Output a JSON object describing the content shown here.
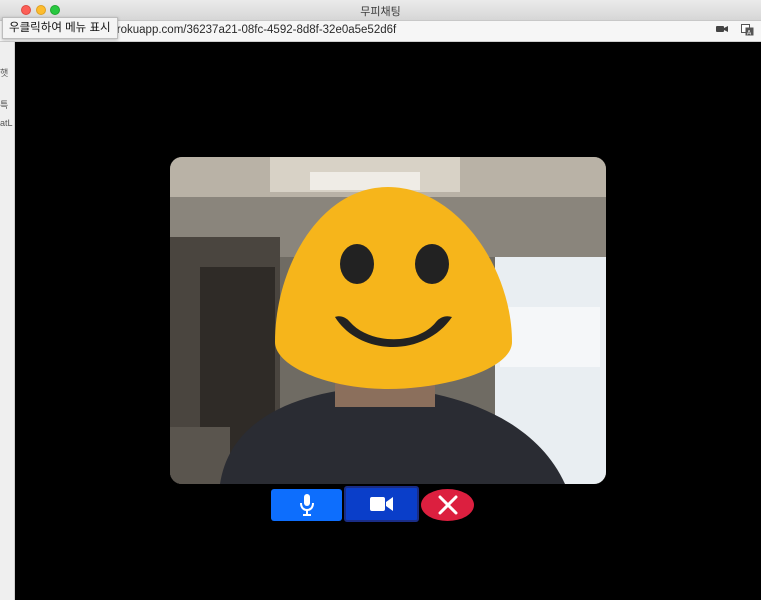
{
  "window": {
    "title": "무피채팅",
    "url": "herokuapp.com/36237a21-08fc-4592-8d8f-32e0a5e52d6f",
    "tooltip": "우클릭하여 메뉴 표시"
  },
  "left_strip": [
    "햇",
    "특",
    "atL"
  ],
  "video": {
    "avatar": "smiley-emoji-over-face",
    "colors": {
      "emoji": "#f6b51b",
      "eyes": "#222222"
    }
  },
  "controls": {
    "mic_icon": "microphone-icon",
    "camera_icon": "video-camera-icon",
    "end_icon": "close-x-icon",
    "colors": {
      "mic": "#0d6efd",
      "camera": "#0a3ec9",
      "end": "#dc1f3f"
    }
  }
}
